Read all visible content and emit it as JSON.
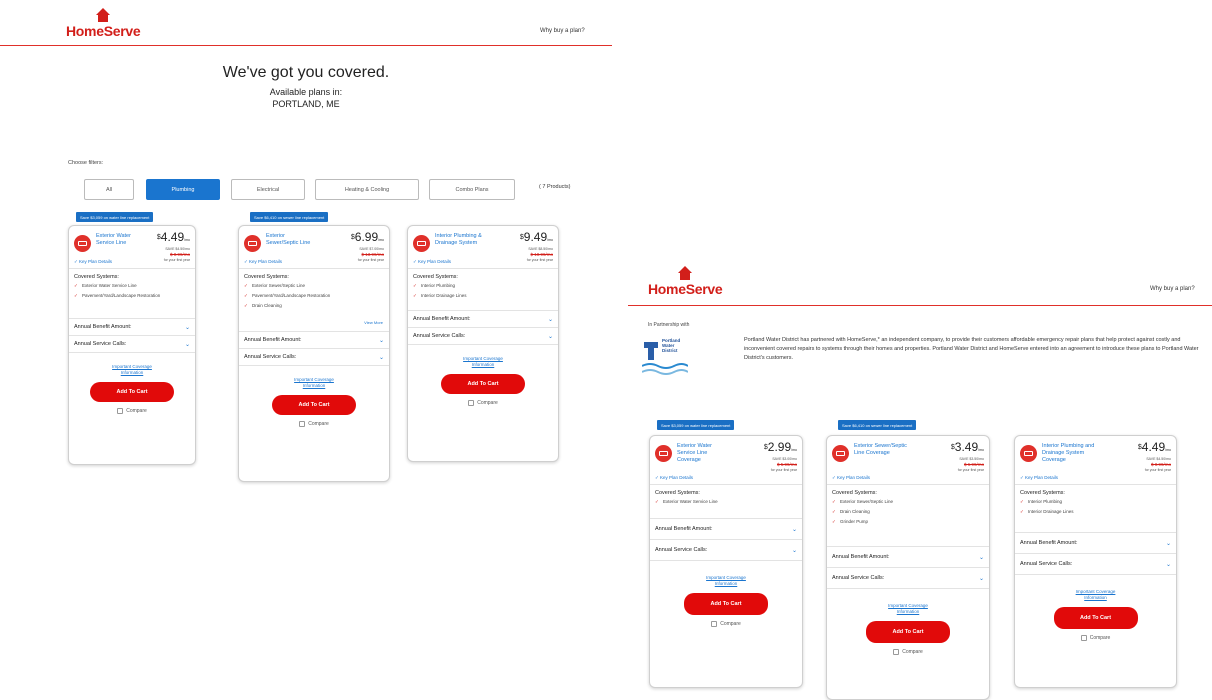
{
  "left": {
    "logo": "HomeServe",
    "why_link": "Why buy a plan?",
    "hero_title": "We've got you covered.",
    "hero_sub1": "Available plans in:",
    "hero_sub2": "PORTLAND, ME",
    "filters_label": "Choose filters:",
    "filters": [
      "All",
      "Plumbing",
      "Electrical",
      "Heating & Cooling",
      "Combo Plans"
    ],
    "active_filter": "Plumbing",
    "products_count": "( 7 Products)",
    "plans": [
      {
        "tag": "Save $3,059 on water line replacement",
        "title": "Exterior Water Service Line",
        "price": "4.49",
        "per": "/mo",
        "save": "SAVE $4.50/mo",
        "old_price": "$ 8.99/mo",
        "first_year": "for your first year",
        "key_details": "Key Plan Details",
        "covered_title": "Covered Systems:",
        "covered": [
          "Exterior Water Service Line",
          "Pavement/Yard/Landscape Restoration"
        ],
        "view_more": "",
        "benefit": "Annual Benefit Amount:",
        "service": "Annual Service Calls:",
        "coverage_link": "Important Coverage Information",
        "cart": "Add To Cart",
        "compare": "Compare"
      },
      {
        "tag": "Save $6,410 on sewer line replacement",
        "title": "Exterior Sewer/Septic Line",
        "price": "6.99",
        "per": "/mo",
        "save": "SAVE $7.00/mo",
        "old_price": "$ 13.99/mo",
        "first_year": "for your first year",
        "key_details": "Key Plan Details",
        "covered_title": "Covered Systems:",
        "covered": [
          "Exterior Sewer/Septic Line",
          "Pavement/Yard/Landscape Restoration",
          "Drain Cleaning"
        ],
        "view_more": "View More",
        "benefit": "Annual Benefit Amount:",
        "service": "Annual Service Calls:",
        "coverage_link": "Important Coverage Information",
        "cart": "Add To Cart",
        "compare": "Compare"
      },
      {
        "tag": "",
        "title": "Interior Plumbing & Drainage System",
        "price": "9.49",
        "per": "/mo",
        "save": "SAVE $8.50/mo",
        "old_price": "$ 18.99/mo",
        "first_year": "for your first year",
        "key_details": "Key Plan Details",
        "covered_title": "Covered Systems:",
        "covered": [
          "Interior Plumbing",
          "Interior Drainage Lines"
        ],
        "view_more": "",
        "benefit": "Annual Benefit Amount:",
        "service": "Annual Service Calls:",
        "coverage_link": "Important Coverage Information",
        "cart": "Add To Cart",
        "compare": "Compare"
      }
    ]
  },
  "right": {
    "logo": "HomeServe",
    "why_link": "Why buy a plan?",
    "partner_label": "In Partnership with",
    "partner_logo": {
      "line1": "Portland",
      "line2": "Water",
      "line3": "District"
    },
    "partner_text": "Portland Water District has partnered with HomeServe,* an independent company, to provide their customers affordable emergency repair plans that help protect against costly and inconvenient covered repairs to systems through their homes and properties. Portland Water District and HomeServe entered into an agreement to introduce these plans to Portland Water District's customers.",
    "plans": [
      {
        "tag": "Save $3,059 on water line replacement",
        "title": "Exterior Water Service Line Coverage",
        "price": "2.99",
        "per": "/mo",
        "save": "SAVE $3.00/mo",
        "old_price": "$ 5.99/mo",
        "first_year": "for your first year",
        "key_details": "Key Plan Details",
        "covered_title": "Covered Systems:",
        "covered": [
          "Exterior Water Service Line"
        ],
        "benefit": "Annual Benefit Amount:",
        "service": "Annual Service Calls:",
        "coverage_link": "Important Coverage Information",
        "cart": "Add To Cart",
        "compare": "Compare"
      },
      {
        "tag": "Save $6,410 on sewer line replacement",
        "title": "Exterior Sewer/Septic Line Coverage",
        "price": "3.49",
        "per": "/mo",
        "save": "SAVE $3.50/mo",
        "old_price": "$ 6.99/mo",
        "first_year": "for your first year",
        "key_details": "Key Plan Details",
        "covered_title": "Covered Systems:",
        "covered": [
          "Exterior Sewer/Septic Line",
          "Drain Cleaning",
          "Grinder Pump"
        ],
        "benefit": "Annual Benefit Amount:",
        "service": "Annual Service Calls:",
        "coverage_link": "Important Coverage Information",
        "cart": "Add To Cart",
        "compare": "Compare"
      },
      {
        "tag": "",
        "title": "Interior Plumbing and Drainage System Coverage",
        "price": "4.49",
        "per": "/mo",
        "save": "SAVE $4.50/mo",
        "old_price": "$ 8.99/mo",
        "first_year": "for your first year",
        "key_details": "Key Plan Details",
        "covered_title": "Covered Systems:",
        "covered": [
          "Interior Plumbing",
          "Interior Drainage Lines"
        ],
        "benefit": "Annual Benefit Amount:",
        "service": "Annual Service Calls:",
        "coverage_link": "Important Coverage Information",
        "cart": "Add To Cart",
        "compare": "Compare"
      }
    ]
  },
  "colors": {
    "brand_red": "#d21f1a",
    "accent_blue": "#1a75cf",
    "cart_red": "#e10a0a"
  }
}
